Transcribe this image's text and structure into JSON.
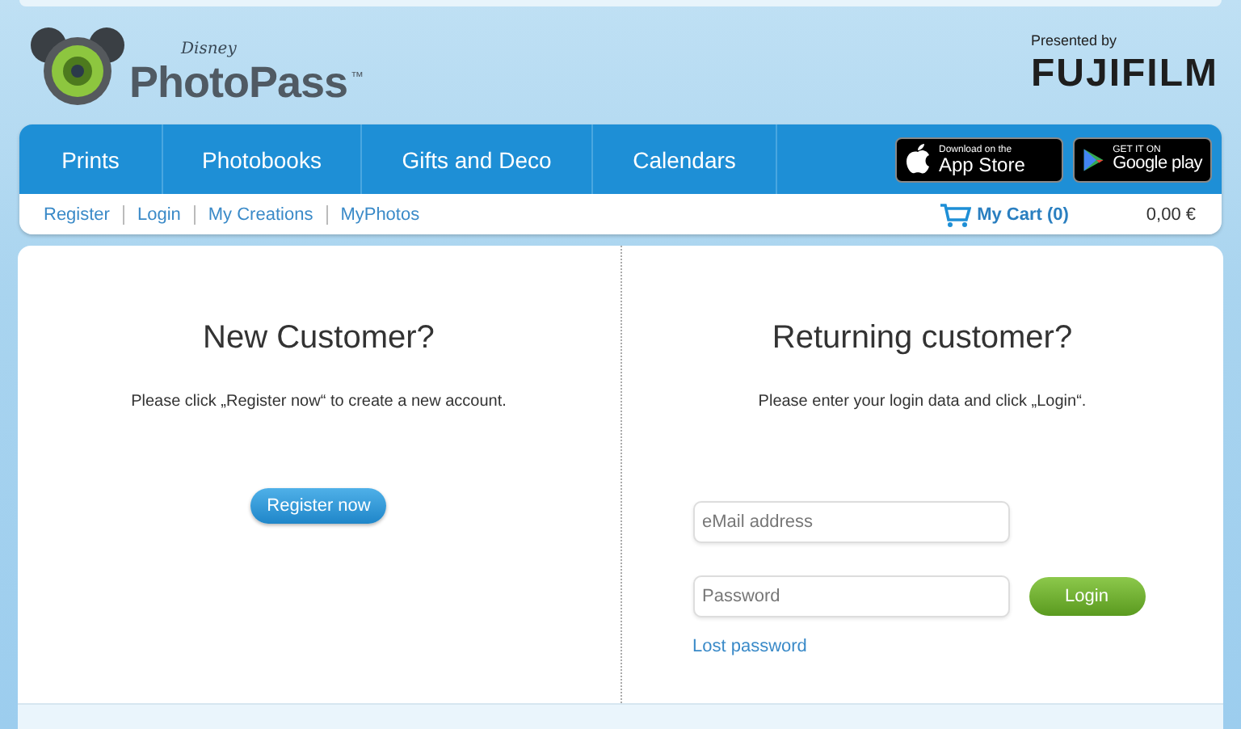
{
  "logo": {
    "brand": "Disney",
    "name": "PhotoPass",
    "mark": "™"
  },
  "sponsor": {
    "caption": "Presented by",
    "name": "FUJIFILM"
  },
  "nav": [
    {
      "label": "Prints"
    },
    {
      "label": "Photobooks"
    },
    {
      "label": "Gifts and Deco"
    },
    {
      "label": "Calendars"
    }
  ],
  "store_badges": [
    {
      "kind": "apple",
      "line1": "Download on the",
      "line2": "App Store"
    },
    {
      "kind": "google",
      "line1": "GET IT ON",
      "line2": "Google play"
    }
  ],
  "subnav": [
    {
      "label": "Register"
    },
    {
      "label": "Login"
    },
    {
      "label": "My Creations"
    },
    {
      "label": "MyPhotos"
    }
  ],
  "cart": {
    "label": "My Cart (0)",
    "total": "0,00 €"
  },
  "new_customer": {
    "title": "New Customer?",
    "text": "Please click „Register now“ to create a new account.",
    "button": "Register now"
  },
  "returning_customer": {
    "title": "Returning customer?",
    "text": "Please enter your login data and click „Login“.",
    "email": {
      "placeholder": "eMail address"
    },
    "password": {
      "placeholder": "Password"
    },
    "button": "Login",
    "link": "Lost password"
  }
}
